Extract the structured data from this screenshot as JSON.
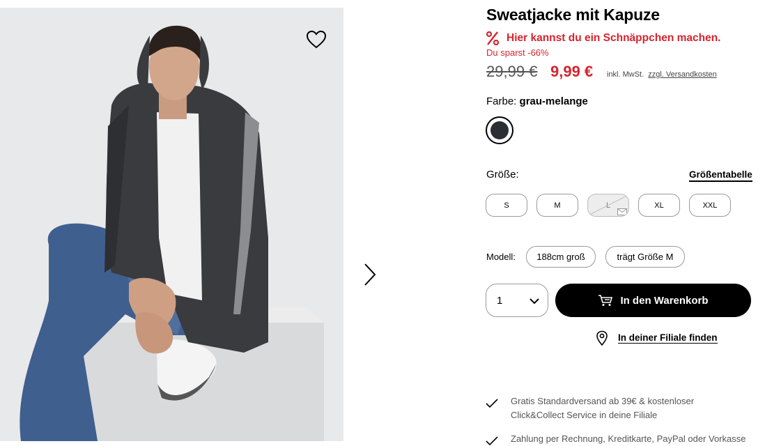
{
  "product": {
    "title": "Sweatjacke mit Kapuze",
    "deal_text": "Hier kannst du ein Schnäppchen machen.",
    "saving_text": "Du sparst -66%",
    "old_price": "29,99 €",
    "new_price": "9,99 €",
    "tax_text": "inkl. MwSt.",
    "shipping_link": "zzgl. Versandkosten"
  },
  "color": {
    "label": "Farbe:",
    "value": "grau-melange",
    "swatch": "#2c2e33"
  },
  "size": {
    "label": "Größe:",
    "table_link": "Größentabelle",
    "options": [
      {
        "label": "S",
        "available": true
      },
      {
        "label": "M",
        "available": true
      },
      {
        "label": "L",
        "available": false
      },
      {
        "label": "XL",
        "available": true
      },
      {
        "label": "XXL",
        "available": true
      }
    ]
  },
  "model": {
    "label": "Modell:",
    "height": "188cm groß",
    "wears": "trägt Größe M"
  },
  "purchase": {
    "quantity": "1",
    "add_to_cart": "In den Warenkorb",
    "find_store": "In deiner Filiale finden"
  },
  "benefits": [
    {
      "line1": "Gratis Standardversand ab 39€ & kostenloser",
      "line2": "Click&Collect Service in deine Filiale"
    },
    {
      "line1": "Zahlung per Rechnung, Kreditkarte, PayPal oder Vorkasse",
      "line2": ""
    }
  ],
  "icons": {
    "wishlist": "heart-icon",
    "next": "chevron-right-icon",
    "deal": "percent-icon",
    "cart": "cart-icon",
    "store": "location-pin-icon",
    "benefit": "check-icon"
  }
}
